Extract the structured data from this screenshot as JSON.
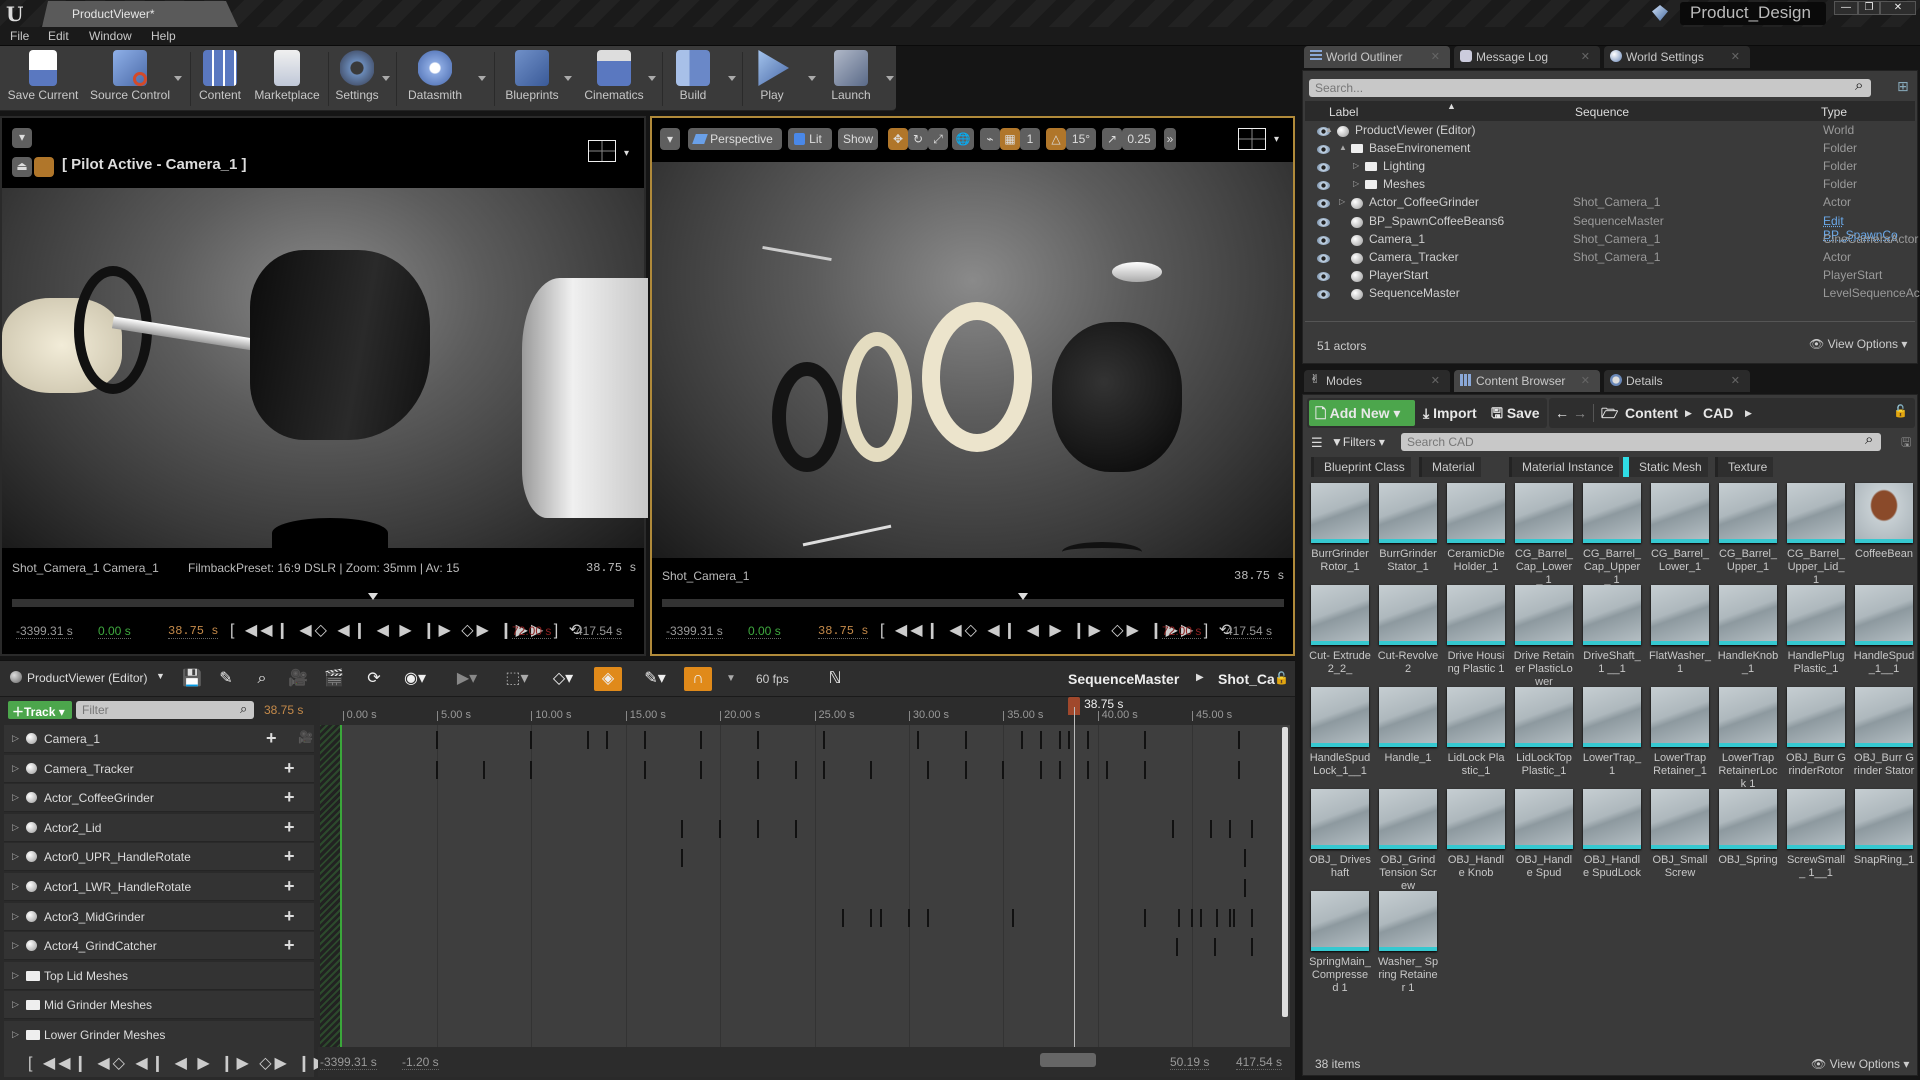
{
  "window": {
    "document_tab": "ProductViewer*",
    "project_name": "Product_Design",
    "controls": [
      "minimize",
      "restore",
      "close"
    ]
  },
  "menu": [
    "File",
    "Edit",
    "Window",
    "Help"
  ],
  "toolbar": [
    {
      "label": "Save Current",
      "icon": "save-icon",
      "dropdown": false
    },
    {
      "label": "Source Control",
      "icon": "source-control-icon",
      "dropdown": true
    },
    {
      "label": "Content",
      "icon": "content-icon",
      "dropdown": false
    },
    {
      "label": "Marketplace",
      "icon": "marketplace-icon",
      "dropdown": false
    },
    {
      "label": "Settings",
      "icon": "settings-icon",
      "dropdown": true
    },
    {
      "label": "Datasmith",
      "icon": "datasmith-icon",
      "dropdown": true
    },
    {
      "label": "Blueprints",
      "icon": "blueprints-icon",
      "dropdown": true
    },
    {
      "label": "Cinematics",
      "icon": "cinematics-icon",
      "dropdown": true
    },
    {
      "label": "Build",
      "icon": "build-icon",
      "dropdown": true
    },
    {
      "label": "Play",
      "icon": "play-icon",
      "dropdown": true
    },
    {
      "label": "Launch",
      "icon": "launch-icon",
      "dropdown": true
    }
  ],
  "viewport_left": {
    "pilot_label": "[ Pilot Active - Camera_1 ]",
    "shot_info": "Shot_Camera_1  Camera_1",
    "filmback": "FilmbackPreset: 16:9 DSLR | Zoom: 35mm | Av: 15",
    "time": "38.75  s",
    "start_bound": "-3399.31 s",
    "in_point": "0.00 s",
    "current": "38.75  s",
    "out_point": "72.00 s",
    "end_bound": "417.54 s",
    "playhead_fraction": 0.5375
  },
  "viewport_right": {
    "view_mode": "Perspective",
    "lighting": "Lit",
    "show": "Show",
    "grid_snap": "1",
    "rotation_snap": "15°",
    "scale_snap": "0.25",
    "shot_info": "Shot_Camera_1",
    "time": "38.75  s",
    "start_bound": "-3399.31 s",
    "in_point": "0.00 s",
    "current": "38.75  s",
    "out_point": "72.00 s",
    "end_bound": "417.54 s",
    "playhead_fraction": 0.5375
  },
  "transport_glyphs": "[ ◀◀❙ ◀◇ ◀❙ ◀ ▶ ❙▶ ◇▶ ❙▶▶ ] ⟲",
  "sequencer": {
    "world": "ProductViewer (Editor)",
    "fps": "60 fps",
    "breadcrumb": [
      "SequenceMaster",
      "Shot_Ca"
    ],
    "add_track": "Track",
    "filter_placeholder": "Filter",
    "current_time": "38.75 s",
    "playhead_label": "38.75 s",
    "view_start": "-3399.31 s",
    "view_in": "-1.20 s",
    "view_out": "50.19 s",
    "view_end": "417.54 s",
    "ruler": {
      "start": -1.2,
      "end": 50.19,
      "labels": [
        "0.00 s",
        "5.00 s",
        "10.00 s",
        "15.00 s",
        "20.00 s",
        "25.00 s",
        "30.00 s",
        "35.00 s",
        "40.00 s",
        "45.00 s"
      ],
      "values": [
        0,
        5,
        10,
        15,
        20,
        25,
        30,
        35,
        40,
        45
      ]
    },
    "playhead_time": 38.75,
    "tracks": [
      {
        "name": "Camera_1",
        "kind": "camera",
        "keys": [
          5,
          10,
          13,
          14,
          16,
          19,
          22,
          25.5,
          30.5,
          33,
          36,
          37,
          38,
          38.5,
          39.5,
          42.5,
          47.5
        ]
      },
      {
        "name": "Camera_Tracker",
        "kind": "actor",
        "keys": [
          5,
          7.5,
          10,
          16,
          19,
          22,
          24,
          25.5,
          28,
          31,
          33,
          35,
          37,
          38,
          39.5,
          40.5,
          42.5,
          47.5
        ]
      },
      {
        "name": "Actor_CoffeeGrinder",
        "kind": "actor",
        "keys": []
      },
      {
        "name": "Actor2_Lid",
        "kind": "actor",
        "keys": [
          18,
          20,
          22,
          24,
          44,
          46,
          47,
          48.2
        ]
      },
      {
        "name": "Actor0_UPR_HandleRotate",
        "kind": "actor",
        "keys": [
          18,
          47.8
        ]
      },
      {
        "name": "Actor1_LWR_HandleRotate",
        "kind": "actor",
        "keys": [
          47.8
        ]
      },
      {
        "name": "Actor3_MidGrinder",
        "kind": "actor",
        "keys": [
          26.5,
          28,
          28.5,
          30,
          31,
          35.5,
          42.5,
          44.3,
          45,
          45.5,
          46.3,
          47,
          47.2,
          48.2
        ]
      },
      {
        "name": "Actor4_GrindCatcher",
        "kind": "actor",
        "keys": [
          44.2,
          46.2,
          48.2
        ]
      },
      {
        "name": "Top Lid Meshes",
        "kind": "folder",
        "keys": []
      },
      {
        "name": "Mid Grinder Meshes",
        "kind": "folder",
        "keys": []
      },
      {
        "name": "Lower Grinder Meshes",
        "kind": "folder",
        "keys": []
      }
    ]
  },
  "outliner": {
    "tabs": [
      "World Outliner",
      "Message Log",
      "World Settings"
    ],
    "search_placeholder": "Search...",
    "columns": [
      "Label",
      "Sequence",
      "Type"
    ],
    "rows": [
      {
        "label": "ProductViewer (Editor)",
        "sequence": "",
        "type": "World",
        "indent": 0,
        "expander": "▲"
      },
      {
        "label": "BaseEnvironement",
        "sequence": "",
        "type": "Folder",
        "indent": 1,
        "expander": "▲"
      },
      {
        "label": "Lighting",
        "sequence": "",
        "type": "Folder",
        "indent": 2,
        "expander": "▷"
      },
      {
        "label": "Meshes",
        "sequence": "",
        "type": "Folder",
        "indent": 2,
        "expander": "▷"
      },
      {
        "label": "Actor_CoffeeGrinder",
        "sequence": "Shot_Camera_1",
        "type": "Actor",
        "indent": 1,
        "expander": "▷"
      },
      {
        "label": "BP_SpawnCoffeeBeans6",
        "sequence": "SequenceMaster",
        "type": "Edit BP_SpawnCo",
        "indent": 1,
        "expander": "",
        "type_link": true
      },
      {
        "label": "Camera_1",
        "sequence": "Shot_Camera_1",
        "type": "CineCameraActor",
        "indent": 1,
        "expander": ""
      },
      {
        "label": "Camera_Tracker",
        "sequence": "Shot_Camera_1",
        "type": "Actor",
        "indent": 1,
        "expander": ""
      },
      {
        "label": "PlayerStart",
        "sequence": "",
        "type": "PlayerStart",
        "indent": 1,
        "expander": ""
      },
      {
        "label": "SequenceMaster",
        "sequence": "",
        "type": "LevelSequenceAct",
        "indent": 1,
        "expander": ""
      }
    ],
    "count": "51 actors",
    "view_options": "View Options"
  },
  "content_browser": {
    "tabs": [
      "Modes",
      "Content Browser",
      "Details"
    ],
    "add_new": "Add New",
    "import": "Import",
    "save_all": "Save All",
    "path": [
      "Content",
      "CAD"
    ],
    "filters_label": "Filters",
    "search_placeholder": "Search CAD",
    "filter_chips": [
      {
        "label": "Blueprint Class",
        "on": false
      },
      {
        "label": "Material",
        "on": false
      },
      {
        "label": "Material Instance",
        "on": false
      },
      {
        "label": "Static Mesh",
        "on": true
      },
      {
        "label": "Texture",
        "on": false
      }
    ],
    "assets": [
      "BurrGrinder Rotor_1",
      "BurrGrinder Stator_1",
      "CeramicDie Holder_1",
      "CG_Barrel_ Cap_Lower_ 1",
      "CG_Barrel_ Cap_Upper_ 1",
      "CG_Barrel_ Lower_1",
      "CG_Barrel_ Upper_1",
      "CG_Barrel_ Upper_Lid_1",
      "CoffeeBean",
      "Cut- Extrude2_2_",
      "Cut-Revolve2",
      "Drive Housing Plastic 1",
      "Drive Retainer PlasticLower",
      "DriveShaft_1 __1",
      "FlatWasher_ 1",
      "HandleKnob _1",
      "HandlePlug Plastic_1",
      "HandleSpud _1__1",
      "HandleSpud Lock_1__1",
      "Handle_1",
      "LidLock Plastic_1",
      "LidLockTop Plastic_1",
      "LowerTrap_1",
      "LowerTrap Retainer_1",
      "LowerTrap RetainerLock 1",
      "OBJ_Burr GrinderRotor",
      "OBJ_Burr Grinder Stator",
      "OBJ_ Driveshaft",
      "OBJ_Grind Tension Screw",
      "OBJ_Handle Knob",
      "OBJ_Handle Spud",
      "OBJ_Handle SpudLock",
      "OBJ_Small Screw",
      "OBJ_Spring",
      "ScrewSmall_ 1__1",
      "SnapRing_1",
      "SpringMain_ Compressed 1",
      "Washer_ Spring Retainer 1"
    ],
    "count": "38 items",
    "view_options": "View Options"
  },
  "colors": {
    "accent_orange": "#b0762a",
    "add_green": "#4ca64c",
    "static_mesh_cyan": "#2fdde6",
    "playhead": "#a0482c"
  }
}
